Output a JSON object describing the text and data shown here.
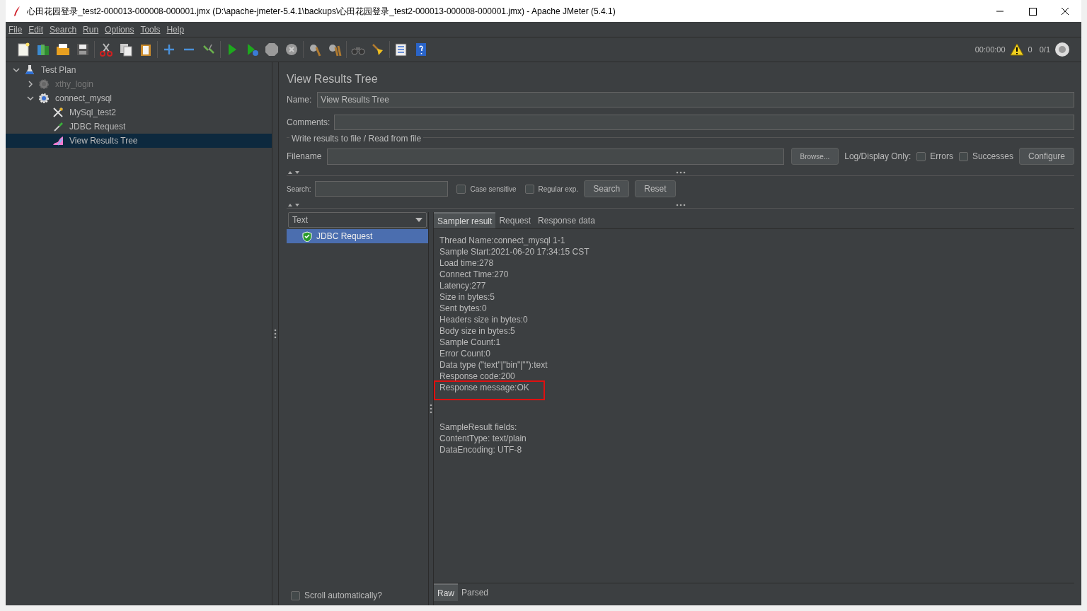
{
  "window": {
    "title": "心田花园登录_test2-000013-000008-000001.jmx (D:\\apache-jmeter-5.4.1\\backups\\心田花园登录_test2-000013-000008-000001.jmx) - Apache JMeter (5.4.1)"
  },
  "menu": [
    "File",
    "Edit",
    "Search",
    "Run",
    "Options",
    "Tools",
    "Help"
  ],
  "toolbar": [
    [
      {
        "kind": "new"
      },
      {
        "kind": "templates"
      },
      {
        "kind": "open"
      },
      {
        "kind": "save"
      }
    ],
    [
      {
        "kind": "cut"
      },
      {
        "kind": "copy"
      },
      {
        "kind": "paste"
      }
    ],
    [
      {
        "kind": "expand"
      },
      {
        "kind": "collapse"
      },
      {
        "kind": "toggle"
      }
    ],
    [
      {
        "kind": "start"
      },
      {
        "kind": "start-no-pause"
      },
      {
        "kind": "stop"
      },
      {
        "kind": "shutdown"
      }
    ],
    [
      {
        "kind": "clear"
      },
      {
        "kind": "clear-all"
      }
    ],
    [
      {
        "kind": "search"
      },
      {
        "kind": "reset-search"
      }
    ],
    [
      {
        "kind": "function-helper"
      },
      {
        "kind": "help"
      }
    ]
  ],
  "status": {
    "elapsed": "00:00:00",
    "warnings": "0",
    "threads": "0/1"
  },
  "tree": [
    {
      "label": "Test Plan",
      "kind": "plan",
      "expanded": true,
      "selected": false,
      "disabled": false,
      "children": [
        {
          "label": "xthy_login",
          "kind": "thread-group",
          "expanded": false,
          "selected": false,
          "disabled": true
        },
        {
          "label": "connect_mysql",
          "kind": "thread-group",
          "expanded": true,
          "selected": false,
          "disabled": false,
          "children": [
            {
              "label": "MySql_test2",
              "kind": "config",
              "selected": false,
              "disabled": false
            },
            {
              "label": "JDBC Request",
              "kind": "sampler",
              "selected": false,
              "disabled": false
            },
            {
              "label": "View Results Tree",
              "kind": "listener",
              "selected": true,
              "disabled": false
            }
          ]
        }
      ]
    }
  ],
  "panel": {
    "title": "View Results Tree",
    "name_label": "Name:",
    "name_value": "View Results Tree",
    "comments_label": "Comments:",
    "file_group": {
      "legend": "Write results to file / Read from file",
      "filename_label": "Filename",
      "browse": "Browse...",
      "log_label": "Log/Display Only:",
      "options": [
        {
          "label": "Errors",
          "checked": false
        },
        {
          "label": "Successes",
          "checked": false
        }
      ],
      "configure": "Configure"
    },
    "search": {
      "label": "Search:",
      "options": [
        {
          "label": "Case sensitive",
          "checked": false
        },
        {
          "label": "Regular exp.",
          "checked": false
        }
      ],
      "search_button": "Search",
      "reset_button": "Reset"
    },
    "renderer": "Text",
    "results": [
      {
        "label": "JDBC Request",
        "success": true,
        "selected": true
      }
    ],
    "scroll": {
      "label": "Scroll automatically?",
      "checked": false
    },
    "tabs": [
      {
        "label": "Sampler result",
        "selected": true
      },
      {
        "label": "Request",
        "selected": false
      },
      {
        "label": "Response data",
        "selected": false
      }
    ],
    "lines": [
      {
        "text": "Thread Name:connect_mysql 1-1",
        "highlighted": false
      },
      {
        "text": "Sample Start:2021-06-20 17:34:15 CST",
        "highlighted": false
      },
      {
        "text": "Load time:278",
        "highlighted": false
      },
      {
        "text": "Connect Time:270",
        "highlighted": false
      },
      {
        "text": "Latency:277",
        "highlighted": false
      },
      {
        "text": "Size in bytes:5",
        "highlighted": false
      },
      {
        "text": "Sent bytes:0",
        "highlighted": false
      },
      {
        "text": "Headers size in bytes:0",
        "highlighted": false
      },
      {
        "text": "Body size in bytes:5",
        "highlighted": false
      },
      {
        "text": "Sample Count:1",
        "highlighted": false
      },
      {
        "text": "Error Count:0",
        "highlighted": false
      },
      {
        "text": "Data type (\"text\"|\"bin\"|\"\"):text",
        "highlighted": false
      },
      {
        "text": "Response code:200",
        "highlighted": false
      },
      {
        "text": "Response message:OK",
        "highlighted": true
      }
    ],
    "field_lines": [
      "SampleResult fields:",
      "ContentType: text/plain",
      "DataEncoding: UTF-8"
    ],
    "bottom_tabs": [
      {
        "label": "Raw",
        "selected": true
      },
      {
        "label": "Parsed",
        "selected": false
      }
    ]
  }
}
